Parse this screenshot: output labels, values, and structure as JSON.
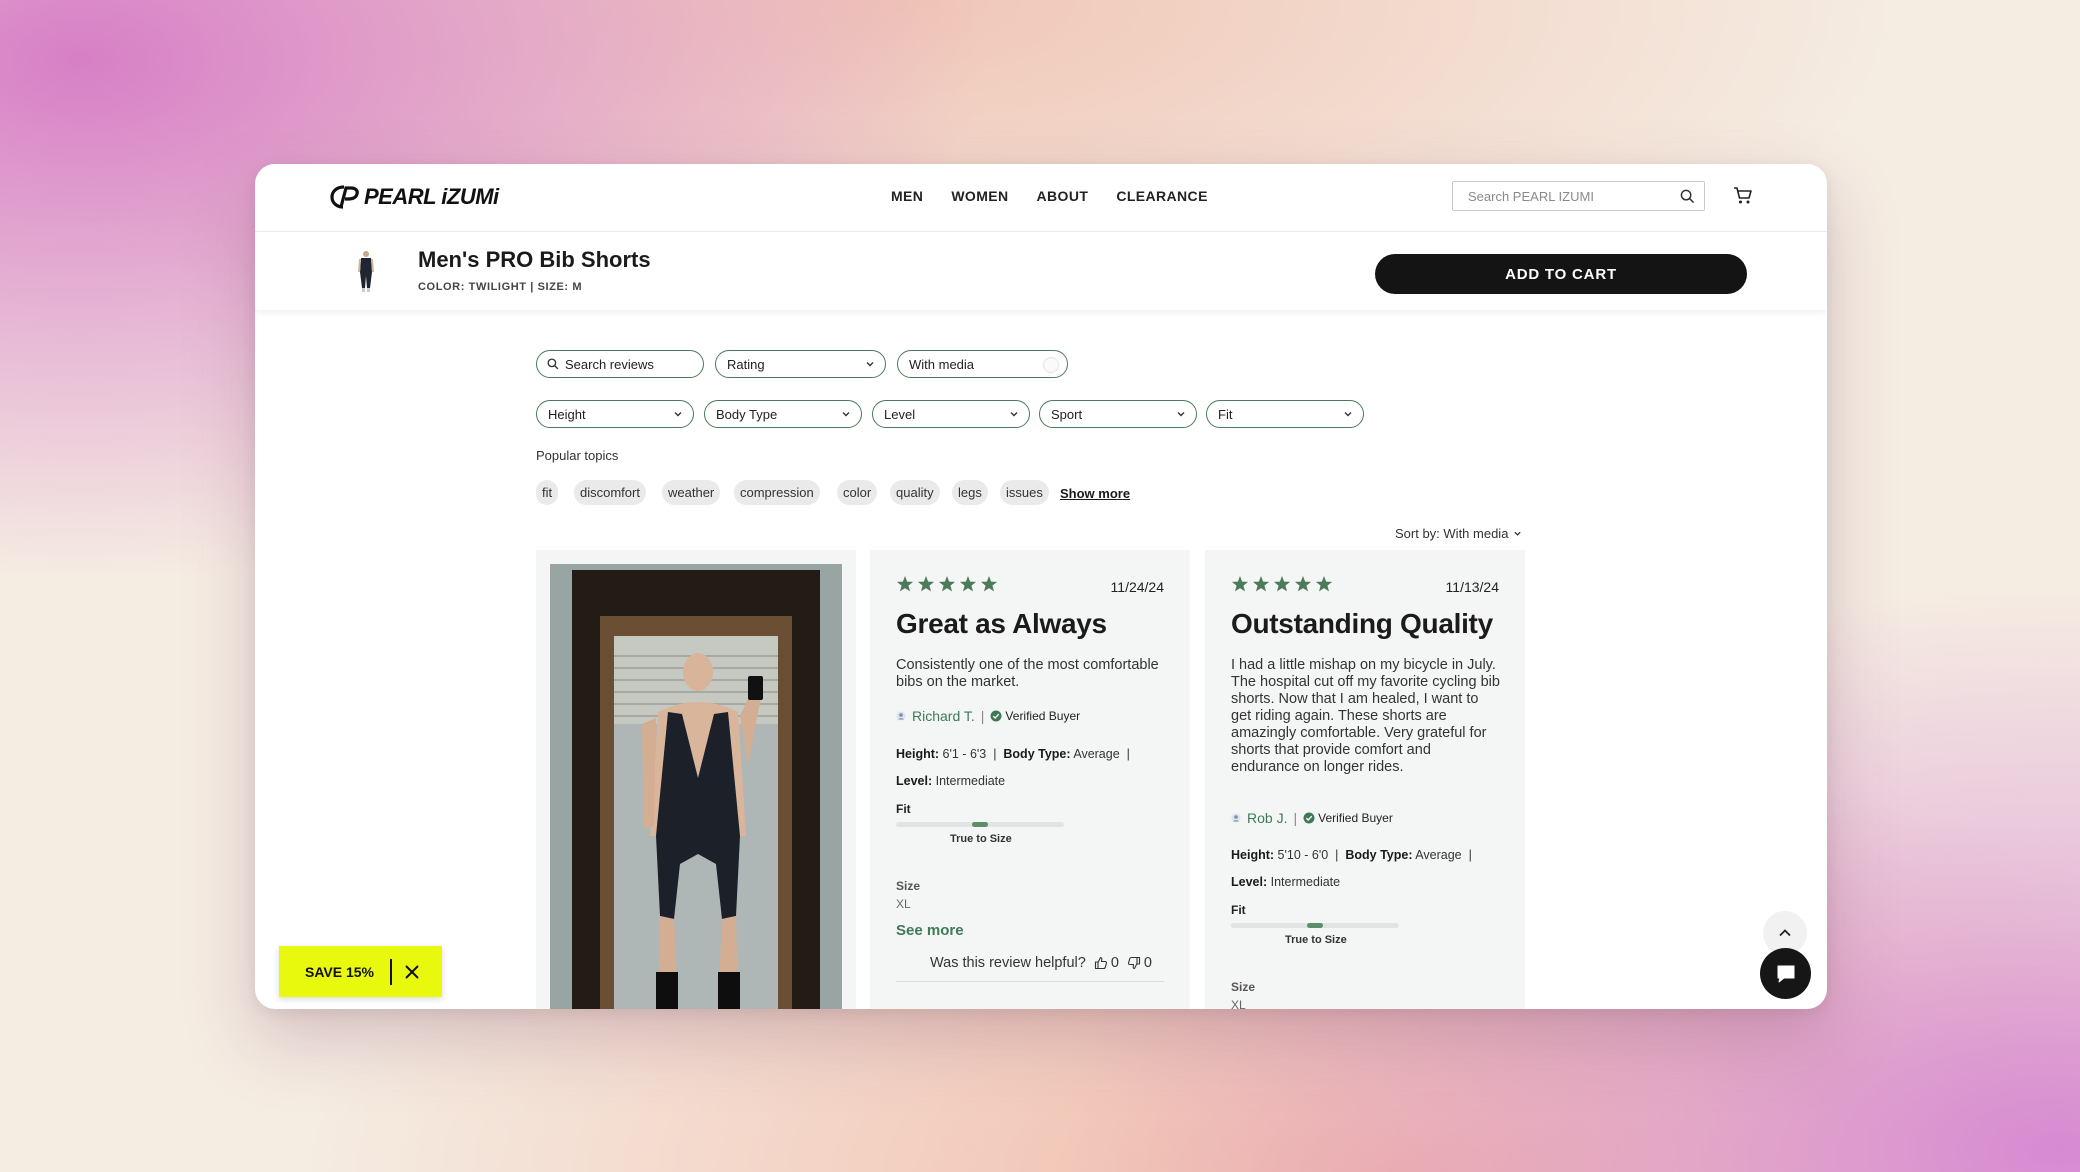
{
  "header": {
    "logo_text": "PEARL iZUMi",
    "nav": [
      "MEN",
      "WOMEN",
      "ABOUT",
      "CLEARANCE"
    ],
    "search_placeholder": "Search PEARL IZUMI"
  },
  "product": {
    "title": "Men's PRO Bib Shorts",
    "meta": "COLOR: TWILIGHT | SIZE: M",
    "add_to_cart": "ADD TO CART"
  },
  "filters": {
    "search_placeholder": "Search reviews",
    "rating": "Rating",
    "with_media": "With media",
    "dropdowns": [
      "Height",
      "Body Type",
      "Level",
      "Sport",
      "Fit"
    ]
  },
  "popular": {
    "label": "Popular topics",
    "topics": [
      "fit",
      "discomfort",
      "weather",
      "compression",
      "color",
      "quality",
      "legs",
      "issues"
    ],
    "show_more": "Show more"
  },
  "sort": {
    "label": "Sort by: With media"
  },
  "reviews": [
    {
      "rating": 5,
      "date": "11/24/24",
      "title": "Great as Always",
      "body": "Consistently one of the most comfortable bibs on the market.",
      "author": "Richard T.",
      "verified": "Verified Buyer",
      "height_label": "Height:",
      "height": "6'1 - 6'3",
      "body_type_label": "Body Type:",
      "body_type": "Average",
      "level_label": "Level:",
      "level": "Intermediate",
      "fit_label": "Fit",
      "fit_text": "True to Size",
      "fit_position": 0.5,
      "size_label": "Size",
      "size": "XL",
      "see_more": "See more",
      "helpful_label": "Was this review helpful?",
      "up_count": "0",
      "down_count": "0"
    },
    {
      "rating": 5,
      "date": "11/13/24",
      "title": "Outstanding Quality",
      "body": "I had a little mishap on my bicycle in July. The hospital cut off my favorite cycling bib shorts. Now that I am healed, I want to get riding again. These shorts are amazingly comfortable. Very grateful for shorts that provide comfort and endurance on longer rides.",
      "author": "Rob J.",
      "verified": "Verified Buyer",
      "height_label": "Height:",
      "height": "5'10 - 6'0",
      "body_type_label": "Body Type:",
      "body_type": "Average",
      "level_label": "Level:",
      "level": "Intermediate",
      "fit_label": "Fit",
      "fit_text": "True to Size",
      "fit_position": 0.5,
      "size_label": "Size",
      "size": "XL"
    }
  ],
  "promo": {
    "label": "SAVE 15%"
  },
  "colors": {
    "accent_green": "#3f7a57",
    "star_green": "#4c7a5b",
    "promo_yellow": "#e8f90e",
    "button_black": "#141414"
  }
}
